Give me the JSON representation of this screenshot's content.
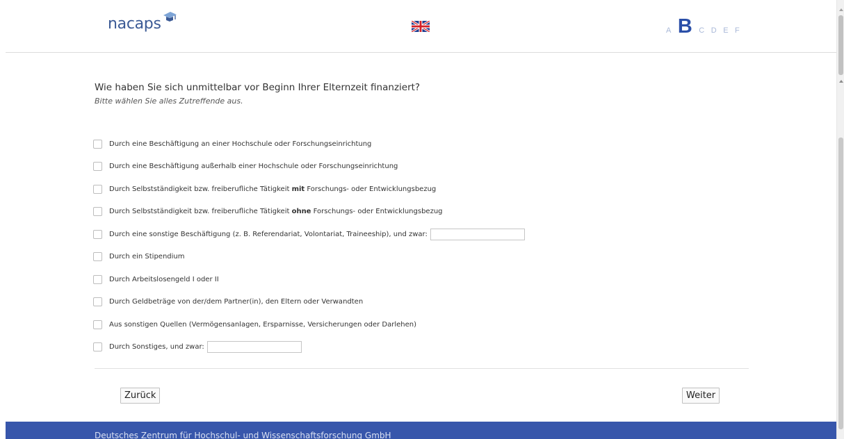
{
  "header": {
    "logo_text": "nacaps",
    "language_flag": "uk-flag-icon",
    "versions": [
      "A",
      "B",
      "C",
      "D",
      "E",
      "F"
    ],
    "active_version": "B"
  },
  "question": {
    "title": "Wie haben Sie sich unmittelbar vor Beginn Ihrer Elternzeit finanziert?",
    "hint": "Bitte wählen Sie alles Zutreffende aus."
  },
  "options": [
    {
      "label": "Durch eine Beschäftigung an einer Hochschule oder Forschungseinrichtung",
      "checked": false
    },
    {
      "label": "Durch eine Beschäftigung außerhalb einer Hochschule oder Forschungseinrichtung",
      "checked": false
    },
    {
      "pre": "Durch Selbstständigkeit bzw. freiberufliche Tätigkeit ",
      "bold": "mit",
      "post": " Forschungs- oder Entwicklungsbezug",
      "checked": false
    },
    {
      "pre": "Durch Selbstständigkeit bzw. freiberufliche Tätigkeit ",
      "bold": "ohne",
      "post": " Forschungs- oder Entwicklungsbezug",
      "checked": false
    },
    {
      "label": "Durch eine sonstige Beschäftigung (z. B. Referendariat, Volontariat, Traineeship), und zwar:",
      "checked": false,
      "input_value": ""
    },
    {
      "label": "Durch ein Stipendium",
      "checked": false
    },
    {
      "label": "Durch Arbeitslosengeld I oder II",
      "checked": false
    },
    {
      "label": "Durch Geldbeträge von der/dem Partner(in), den Eltern oder Verwandten",
      "checked": false
    },
    {
      "label": "Aus sonstigen Quellen (Vermögensanlagen, Ersparnisse, Versicherungen oder Darlehen)",
      "checked": false
    },
    {
      "label": "Durch Sonstiges, und zwar:",
      "checked": false,
      "input_value": ""
    }
  ],
  "nav": {
    "back_label": "Zurück",
    "next_label": "Weiter"
  },
  "footer": {
    "text": "Deutsches Zentrum für Hochschul- und Wissenschaftsforschung GmbH"
  },
  "colors": {
    "brand": "#3b5a95",
    "active_version": "#2b4fa8",
    "footer_bg": "#3756ab"
  }
}
